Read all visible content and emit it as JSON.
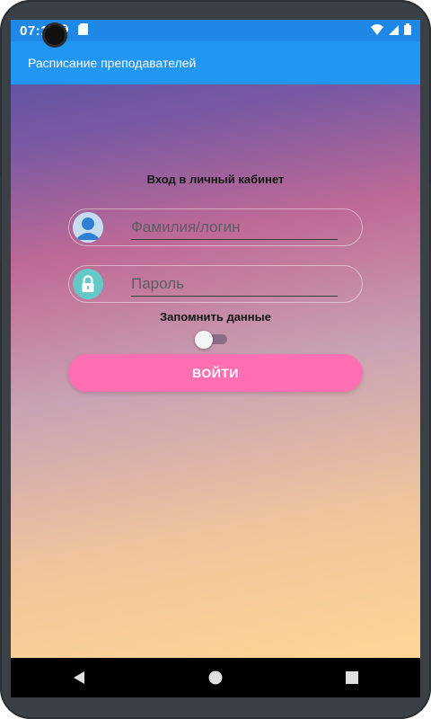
{
  "status_bar": {
    "time": "07:1"
  },
  "app_bar": {
    "title": "Расписание преподавателей"
  },
  "login": {
    "title": "Вход в личный кабинет",
    "login_placeholder": "Фамилия/логин",
    "password_placeholder": "Пароль",
    "remember_label": "Запомнить данные",
    "remember_on": false,
    "submit_label": "ВОЙТИ"
  },
  "colors": {
    "status_bar": "#1f88e6",
    "app_bar": "#2196f3",
    "submit_button": "#ff6fb2",
    "user_icon_bg": "#c6dcf2",
    "lock_icon_bg": "#63c8c6"
  },
  "icons": {
    "user": "user-avatar-icon",
    "lock": "lock-icon",
    "nav": [
      "back-icon",
      "home-icon",
      "recents-icon"
    ]
  }
}
